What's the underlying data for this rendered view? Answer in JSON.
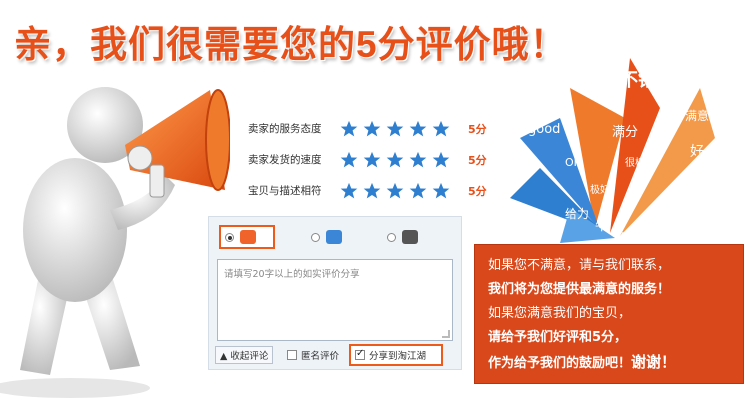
{
  "headline": "亲，我们很需要您的5分评价哦！",
  "ratings": [
    {
      "label": "卖家的服务态度",
      "stars": 5,
      "score": "5分"
    },
    {
      "label": "卖家发货的速度",
      "stars": 5,
      "score": "5分"
    },
    {
      "label": "宝贝与描述相符",
      "stars": 5,
      "score": "5分"
    }
  ],
  "review_panel": {
    "options": [
      {
        "icon": "smile-face-icon",
        "selected": true
      },
      {
        "icon": "neutral-face-icon",
        "selected": false
      },
      {
        "icon": "sad-face-icon",
        "selected": false
      }
    ],
    "textarea_placeholder": "请填写20字以上的如实评价分享",
    "collapse_label": "▲ 收起评论",
    "anonymous_label": "匿名评价",
    "anonymous_checked": false,
    "share_label": "分享到淘江湖",
    "share_checked": true
  },
  "burst_words": [
    "不错",
    "满分",
    "满意",
    "good",
    "很棒",
    "好",
    "OK",
    "优",
    "极好",
    "给力",
    "牛",
    "5分"
  ],
  "message": {
    "line1": "如果您不满意，请与我们联系，",
    "line2": "我们将为您提供最满意的服务！",
    "line3": "如果您满意我们的宝贝，",
    "line4": "请给予我们好评和5分，",
    "line5_prefix": "作为给予我们的鼓励吧！",
    "line5_thanks": "谢谢！"
  },
  "colors": {
    "accent": "#e8501a",
    "star": "#2f7fd0",
    "message_bg": "#d9481b"
  }
}
